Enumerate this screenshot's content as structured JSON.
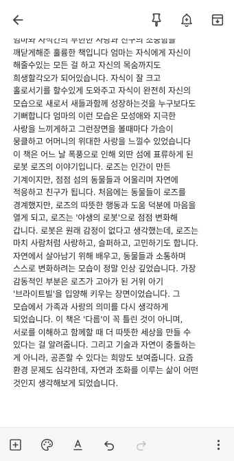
{
  "toolbar": {
    "icons": [
      "back-arrow-icon",
      "pin-icon",
      "reminder-bell-icon",
      "archive-icon"
    ]
  },
  "note": {
    "body": "엄마와 자식간의 부한한 사랑과 친구의 소중함을\n깨닫게해준 훌륭한 책입니다 엄마는 자식에게 자신이\n해줄수있는 모든 걸 하고 자신의 목숨까지도\n희생할각오가 되어있습니다. 자식이 잘 크고\n홀로서기를 할수있게 도와주고 자식이 완전히 자신의\n모습으로 새로서 새들과함께 성장하는것을 누구보다도\n기뻐합니다 엄마의 이런 모습은 모성애와 지극한\n사랑을 느끼게하고 그런장면을 볼때마다 가슴이\n뭉클하고 어머니의 위대한 사랑을 느낄수 있었습니다\n이 책은 어느 날 폭풍으로 인해 외딴 섬에 표류하게 된\n로봇 로즈의 이야기입니다. 로즈는 인간이 만든\n기계이지만, 점점 섬의 동물들과 어울리며 자연에\n적응하고 친구가 됩니다. 처음에는 동물들이 로즈를\n경계했지만, 로즈의 따뜻한 행동과 도움 덕분에 마음을\n열게 되고, 로즈는 '야생의 로봇'으로 점점 변화해\n갑니다. 로봇은 원래 감정이 없다고 생각했는데, 로즈는\n마치 사람처럼 사랑하고, 슬퍼하고, 고민하기도 합니다.\n자연에서 살아남기 위해 배우고, 동물들과 소통하며\n스스로 변화하려는 모습이 정말 인상 깊었습니다. 가장\n감동적인 부분은 로즈가 고아가 된 거위 아기\n'브라이트빌'을 입양해 키우는 장면이었습니다. 그\n모습에서 가족과 사랑의 의미를 다시 생각하게\n되었습니다. 이 책은 '다름'이 꼭 틀린 것이 아니며,\n서로를 이해하고 함께할 때 더 따뜻한 세상을 만들 수\n있다는 걸 알려줍니다. 그리고 기술과 자연이 충돌하는\n게 아니라, 공존할 수 있다는 희망도 보여줍니다. 요즘\n환경 문제도 심각한데, 자연과 조화를 이루는 삶이 어떤\n것인지 생각해보게 되었습니다."
  },
  "bottom_toolbar": {
    "icons": [
      "add-box-icon",
      "palette-icon",
      "text-format-icon",
      "undo-icon",
      "redo-icon",
      "more-vert-icon"
    ]
  },
  "colors": {
    "text": "#202124",
    "bottom_bar_bg": "#f6f6f6",
    "icon": "#3c4043",
    "icon_disabled": "#c4c4c4"
  }
}
